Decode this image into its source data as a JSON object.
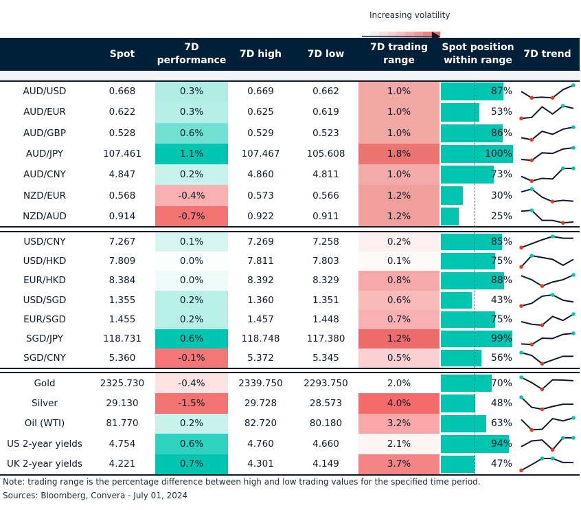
{
  "legend": {
    "label": "Increasing volatility",
    "gradient": [
      "#fdeeee",
      "#fbe0e0",
      "#f9d0d0",
      "#f7c0bf",
      "#f5aeac",
      "#f29a97",
      "#ef8582",
      "#ec706c"
    ]
  },
  "header": {
    "pair": "",
    "spot": "Spot",
    "perf": "7D performance",
    "high": "7D high",
    "low": "7D low",
    "range": "7D trading range",
    "position": "Spot position within range",
    "trend": "7D trend"
  },
  "colors": {
    "header_bg": "#00203a",
    "bar": "#00c5b0",
    "max_marker": "#00c5b0",
    "min_marker": "#e03a2f",
    "line": "#0b1a2b"
  },
  "chart_data": {
    "type": "table",
    "groups": [
      {
        "rows": [
          {
            "pair": "AUD/USD",
            "spot": "0.668",
            "perf": "0.3%",
            "perf_color": "#b2ede4",
            "high": "0.669",
            "low": "0.662",
            "range": "1.0%",
            "range_color": "#f2a8a5",
            "position": 87,
            "trend": [
              0.5,
              0,
              0.05,
              0,
              0.65,
              1
            ]
          },
          {
            "pair": "AUD/EUR",
            "spot": "0.622",
            "perf": "0.3%",
            "perf_color": "#b6efe6",
            "high": "0.625",
            "low": "0.619",
            "range": "1.0%",
            "range_color": "#f2a8a5",
            "position": 53,
            "trend": [
              0,
              0.08,
              0.92,
              0.35,
              1,
              0.8
            ]
          },
          {
            "pair": "AUD/GBP",
            "spot": "0.528",
            "perf": "0.6%",
            "perf_color": "#72e0d2",
            "high": "0.529",
            "low": "0.523",
            "range": "1.0%",
            "range_color": "#f2a8a5",
            "position": 86,
            "trend": [
              0.16,
              0,
              0.67,
              0.43,
              0.84,
              1
            ]
          },
          {
            "pair": "AUD/JPY",
            "spot": "107.461",
            "perf": "1.1%",
            "perf_color": "#00c5b0",
            "high": "107.467",
            "low": "105.608",
            "range": "1.8%",
            "range_color": "#ea7470",
            "position": 100,
            "trend": [
              0.07,
              0,
              0.6,
              0.55,
              0.9,
              1
            ]
          },
          {
            "pair": "AUD/CNY",
            "spot": "4.847",
            "perf": "0.2%",
            "perf_color": "#c8f3ec",
            "high": "4.860",
            "low": "4.811",
            "range": "1.0%",
            "range_color": "#f2aba8",
            "position": 73,
            "trend": [
              0.37,
              0,
              0.21,
              0.16,
              1,
              1
            ]
          },
          {
            "pair": "NZD/EUR",
            "spot": "0.568",
            "perf": "-0.4%",
            "perf_color": "#f9b0b0",
            "high": "0.573",
            "low": "0.566",
            "range": "1.2%",
            "range_color": "#efa09c",
            "position": 30,
            "trend": [
              0.77,
              1,
              0.35,
              0,
              0.1,
              0.03
            ]
          },
          {
            "pair": "NZD/AUD",
            "spot": "0.914",
            "perf": "-0.7%",
            "perf_color": "#f37373",
            "high": "0.922",
            "low": "0.911",
            "range": "1.2%",
            "range_color": "#efa09c",
            "position": 25,
            "trend": [
              0.93,
              1,
              0.2,
              0.2,
              0,
              0.07
            ]
          }
        ]
      },
      {
        "rows": [
          {
            "pair": "USD/CNY",
            "spot": "7.267",
            "perf": "0.1%",
            "perf_color": "#d8f6f1",
            "high": "7.269",
            "low": "7.258",
            "range": "0.2%",
            "range_color": "#fdf0f0",
            "position": 85,
            "trend": [
              0,
              0.35,
              0.7,
              1,
              0.84,
              0.84
            ]
          },
          {
            "pair": "USD/HKD",
            "spot": "7.809",
            "perf": "0.0%",
            "perf_color": "#fafffe",
            "high": "7.811",
            "low": "7.803",
            "range": "0.1%",
            "range_color": "#fffafa",
            "position": 75,
            "trend": [
              0,
              1,
              0.84,
              0.67,
              0.14,
              0.67
            ]
          },
          {
            "pair": "EUR/HKD",
            "spot": "8.384",
            "perf": "0.0%",
            "perf_color": "#eefbf8",
            "high": "8.392",
            "low": "8.329",
            "range": "0.8%",
            "range_color": "#f7a8a8",
            "position": 88,
            "trend": [
              0.93,
              0.57,
              0,
              0.36,
              0.57,
              1
            ]
          },
          {
            "pair": "USD/SGD",
            "spot": "1.355",
            "perf": "0.2%",
            "perf_color": "#b8efe7",
            "high": "1.360",
            "low": "1.351",
            "range": "0.6%",
            "range_color": "#f9baba",
            "position": 43,
            "trend": [
              0,
              0.24,
              0.88,
              1,
              0.52,
              0.36
            ]
          },
          {
            "pair": "EUR/SGD",
            "spot": "1.455",
            "perf": "0.2%",
            "perf_color": "#b8efe7",
            "high": "1.457",
            "low": "1.448",
            "range": "0.7%",
            "range_color": "#f8b0b0",
            "position": 75,
            "trend": [
              0.32,
              0.09,
              0,
              0.79,
              0.43,
              1
            ]
          },
          {
            "pair": "SGD/JPY",
            "spot": "118.731",
            "perf": "0.6%",
            "perf_color": "#00c5b0",
            "high": "118.748",
            "low": "117.380",
            "range": "1.2%",
            "range_color": "#ee6b6b",
            "position": 99,
            "trend": [
              0.05,
              0,
              0.57,
              0.54,
              0.91,
              1
            ]
          },
          {
            "pair": "SGD/CNY",
            "spot": "5.360",
            "perf": "-0.1%",
            "perf_color": "#f57676",
            "high": "5.372",
            "low": "5.345",
            "range": "0.5%",
            "range_color": "#fbd0d0",
            "position": 56,
            "trend": [
              1,
              0.74,
              0,
              0.34,
              0.67,
              0.67
            ]
          }
        ]
      },
      {
        "rows": [
          {
            "pair": "Gold",
            "spot": "2325.730",
            "perf": "-0.4%",
            "perf_color": "#fde2e2",
            "high": "2339.750",
            "low": "2293.750",
            "range": "2.0%",
            "range_color": "#ffffff",
            "position": 70,
            "trend": [
              1,
              0.56,
              0,
              0.79,
              0.77,
              0.72
            ]
          },
          {
            "pair": "Silver",
            "spot": "29.130",
            "perf": "-1.5%",
            "perf_color": "#f37373",
            "high": "29.728",
            "low": "28.573",
            "range": "4.0%",
            "range_color": "#f36b6b",
            "position": 48,
            "trend": [
              1,
              0.16,
              0,
              0.23,
              0.42,
              0.42
            ]
          },
          {
            "pair": "Oil (WTI)",
            "spot": "81.770",
            "perf": "0.2%",
            "perf_color": "#c8f3ec",
            "high": "82.720",
            "low": "80.180",
            "range": "3.2%",
            "range_color": "#f8a8a8",
            "position": 63,
            "trend": [
              0.86,
              0,
              0.05,
              0.94,
              0.75,
              1
            ]
          },
          {
            "pair": "US 2-year yields",
            "spot": "4.754",
            "perf": "0.6%",
            "perf_color": "#2ed2bf",
            "high": "4.760",
            "low": "4.660",
            "range": "2.1%",
            "range_color": "#fff5f5",
            "position": 94,
            "trend": [
              0.26,
              0.74,
              0.82,
              0,
              1,
              1
            ]
          },
          {
            "pair": "UK 2-year yields",
            "spot": "4.221",
            "perf": "0.7%",
            "perf_color": "#00c5b0",
            "high": "4.301",
            "low": "4.149",
            "range": "3.7%",
            "range_color": "#f58585",
            "position": 47,
            "trend": [
              0,
              0.48,
              1,
              1,
              0.66,
              0.66
            ]
          }
        ]
      }
    ]
  },
  "footer": {
    "note": "Note: trading range is the percentage difference between high and low trading values for the specified time period.",
    "sources": "Sources: Bloomberg, Convera - July 01, 2024"
  }
}
